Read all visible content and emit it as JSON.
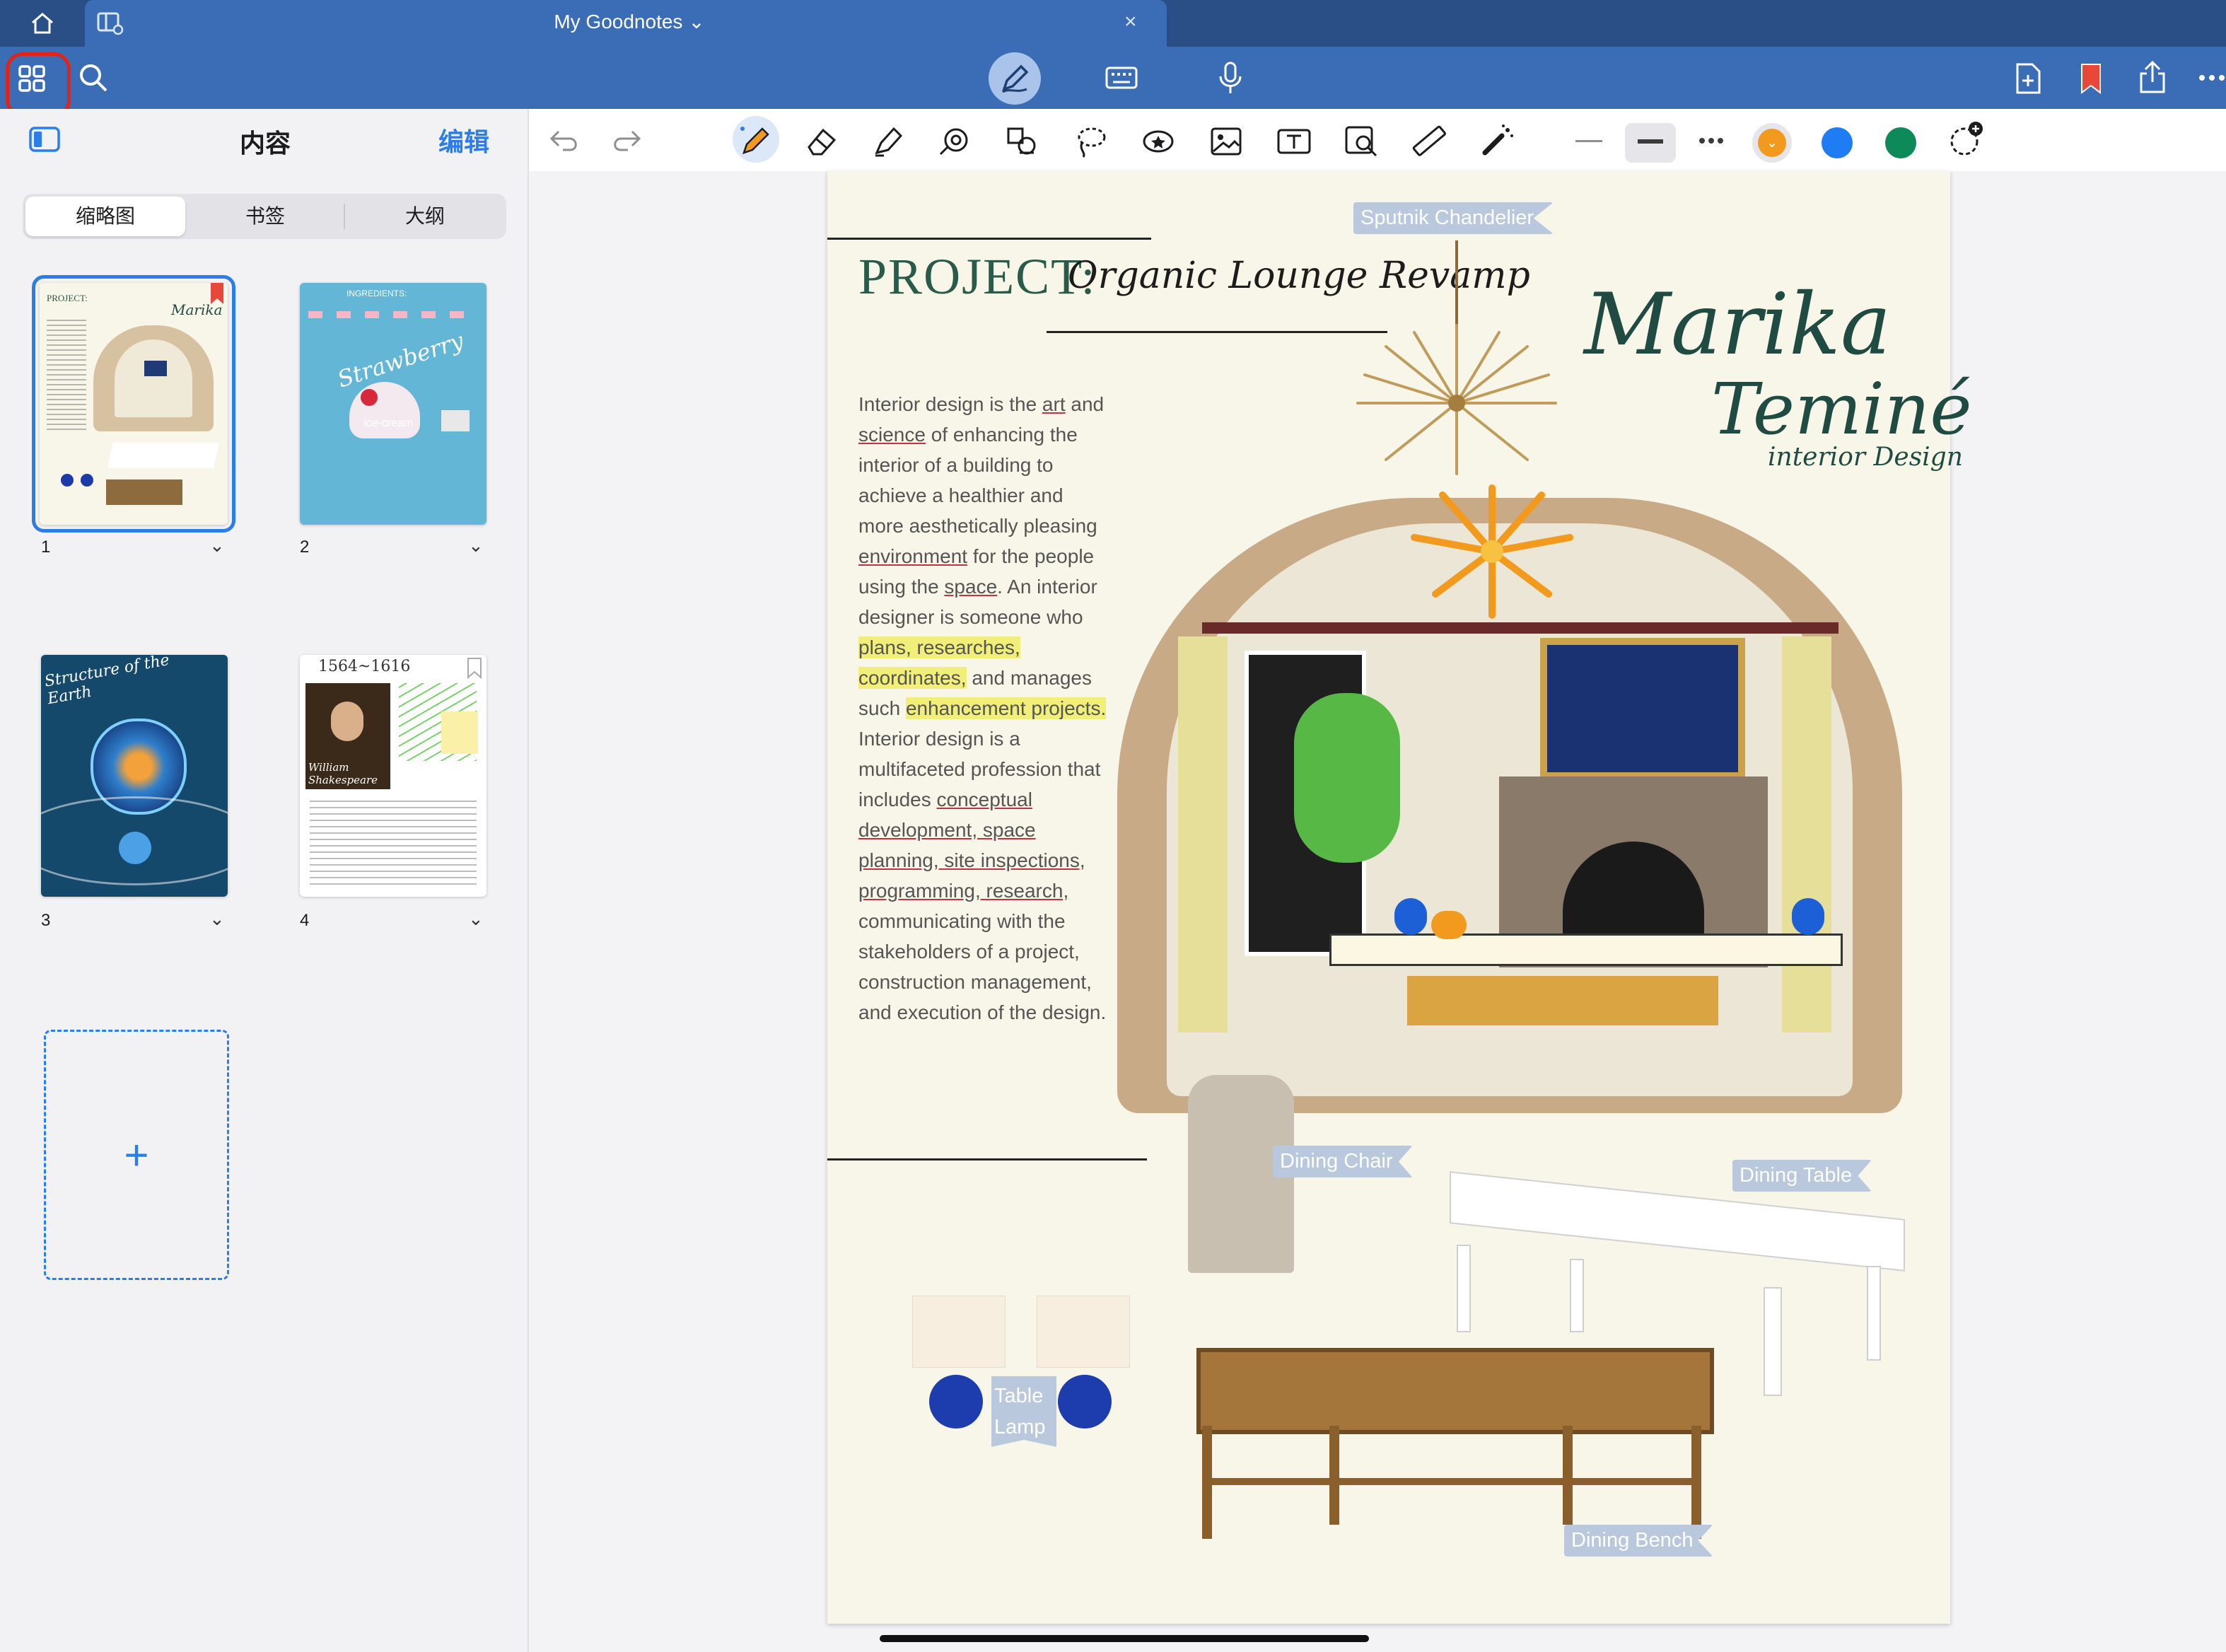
{
  "tabbar": {
    "title": "My Goodnotes ⌄",
    "close": "×"
  },
  "sidebar": {
    "title": "内容",
    "edit": "编辑",
    "tabs": [
      "缩略图",
      "书签",
      "大纲"
    ],
    "pages": [
      {
        "num": "1",
        "mini_title": "PROJECT:",
        "mini_name": "Marika"
      },
      {
        "num": "2",
        "mini_title": "Strawberry",
        "mini_sub": "ice-cream",
        "mini_heading": "INGREDIENTS:"
      },
      {
        "num": "3",
        "mini_title": "Structure of the Earth"
      },
      {
        "num": "4",
        "mini_title": "1564~1616",
        "mini_name": "William Shakespeare"
      }
    ],
    "add_page": "+"
  },
  "colors": {
    "accent": "#2b7de9",
    "orange": "#f29a1d",
    "blue": "#1f7cf2",
    "green": "#0e8a5a"
  },
  "page": {
    "project_label": "PROJECT:",
    "project_name": "Organic Lounge Revamp",
    "brand_line1": "Marika",
    "brand_line2": "Teminé",
    "brand_line3": "interior Design",
    "body": {
      "p1": "Interior design is the ",
      "art": "art",
      "p2": " and ",
      "science": "science",
      "p3": " of enhancing the interior of a building to achieve a healthier and more aesthetically pleasing ",
      "environment": "environment",
      "p4": " for the people using the ",
      "space": "space",
      "p5": ". An interior designer is someone who ",
      "h1": "plans, researches, coordinates,",
      "p6": " and manages such ",
      "h2": "enhancement projects.",
      "p7": " Interior design is a multifaceted profession that includes ",
      "u1": "conceptual development, space planning, site inspections, programming, research,",
      "p8": " communicating with the stakeholders of a project, construction management, and execution of the design."
    },
    "tags": {
      "chandelier": "Sputnik Chandelier",
      "chair": "Dining Chair",
      "table": "Dining Table",
      "lamp": "Table Lamp",
      "bench": "Dining Bench"
    }
  }
}
